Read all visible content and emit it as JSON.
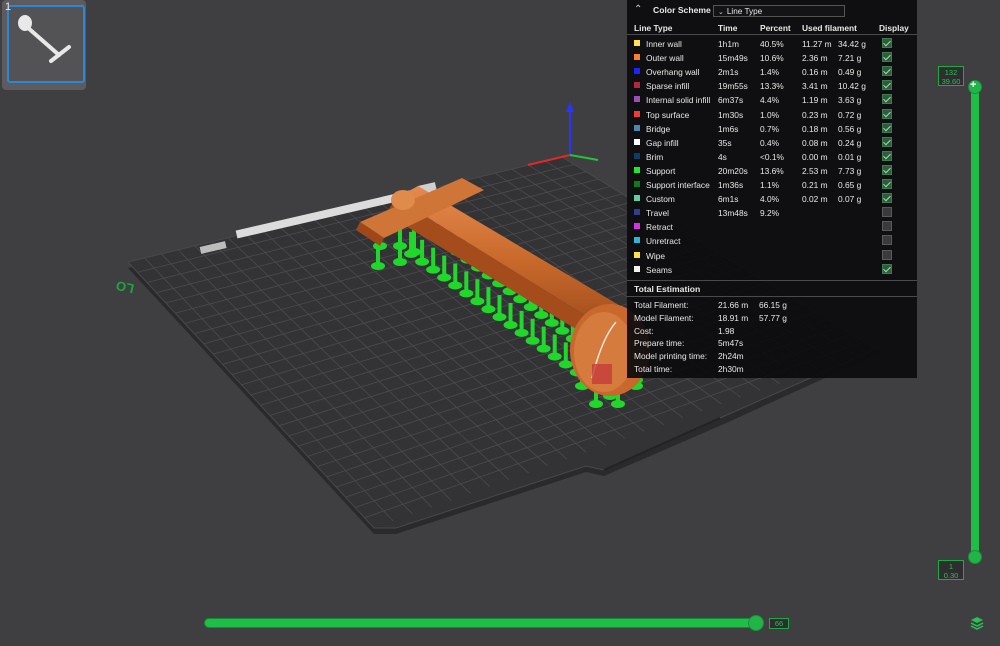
{
  "plate": {
    "number": "1"
  },
  "bed_label": "LO",
  "legend": {
    "title": "Color Scheme",
    "scheme": "Line Type",
    "headers": {
      "line_type": "Line Type",
      "time": "Time",
      "percent": "Percent",
      "used_filament": "Used filament",
      "display": "Display"
    },
    "rows": [
      {
        "name": "Inner wall",
        "time": "1h1m",
        "percent": "40.5%",
        "length": "11.27 m",
        "weight": "34.42 g",
        "color": "#ffe14d",
        "display": true
      },
      {
        "name": "Outer wall",
        "time": "15m49s",
        "percent": "10.6%",
        "length": "2.36 m",
        "weight": "7.21 g",
        "color": "#ff7c2a",
        "display": true
      },
      {
        "name": "Overhang wall",
        "time": "2m1s",
        "percent": "1.4%",
        "length": "0.16 m",
        "weight": "0.49 g",
        "color": "#1a24ff",
        "display": true
      },
      {
        "name": "Sparse infill",
        "time": "19m55s",
        "percent": "13.3%",
        "length": "3.41 m",
        "weight": "10.42 g",
        "color": "#b3283b",
        "display": true
      },
      {
        "name": "Internal solid infill",
        "time": "6m37s",
        "percent": "4.4%",
        "length": "1.19 m",
        "weight": "3.63 g",
        "color": "#9a4fb8",
        "display": true
      },
      {
        "name": "Top surface",
        "time": "1m30s",
        "percent": "1.0%",
        "length": "0.23 m",
        "weight": "0.72 g",
        "color": "#f23a3a",
        "display": true
      },
      {
        "name": "Bridge",
        "time": "1m6s",
        "percent": "0.7%",
        "length": "0.18 m",
        "weight": "0.56 g",
        "color": "#4d84b3",
        "display": true
      },
      {
        "name": "Gap infill",
        "time": "35s",
        "percent": "0.4%",
        "length": "0.08 m",
        "weight": "0.24 g",
        "color": "#ffffff",
        "display": true
      },
      {
        "name": "Brim",
        "time": "4s",
        "percent": "<0.1%",
        "length": "0.00 m",
        "weight": "0.01 g",
        "color": "#0d3d66",
        "display": true
      },
      {
        "name": "Support",
        "time": "20m20s",
        "percent": "13.6%",
        "length": "2.53 m",
        "weight": "7.73 g",
        "color": "#1ee82a",
        "display": true
      },
      {
        "name": "Support interface",
        "time": "1m36s",
        "percent": "1.1%",
        "length": "0.21 m",
        "weight": "0.65 g",
        "color": "#0f7a1a",
        "display": true
      },
      {
        "name": "Custom",
        "time": "6m1s",
        "percent": "4.0%",
        "length": "0.02 m",
        "weight": "0.07 g",
        "color": "#5ecf9f",
        "display": true
      },
      {
        "name": "Travel",
        "time": "13m48s",
        "percent": "9.2%",
        "length": "",
        "weight": "",
        "color": "#2f3e8f",
        "display": false
      },
      {
        "name": "Retract",
        "time": "",
        "percent": "",
        "length": "",
        "weight": "",
        "color": "#d633e0",
        "display": false
      },
      {
        "name": "Unretract",
        "time": "",
        "percent": "",
        "length": "",
        "weight": "",
        "color": "#2fb3d6",
        "display": false
      },
      {
        "name": "Wipe",
        "time": "",
        "percent": "",
        "length": "",
        "weight": "",
        "color": "#ffe24a",
        "display": false
      },
      {
        "name": "Seams",
        "time": "",
        "percent": "",
        "length": "",
        "weight": "",
        "color": "#f2f2f2",
        "display": true
      }
    ]
  },
  "totals": {
    "title": "Total Estimation",
    "rows": [
      {
        "label": "Total Filament:",
        "v1": "21.66 m",
        "v2": "66.15 g"
      },
      {
        "label": "Model Filament:",
        "v1": "18.91 m",
        "v2": "57.77 g"
      },
      {
        "label": "Cost:",
        "v1": "1.98",
        "v2": ""
      },
      {
        "label": "Prepare time:",
        "v1": "5m47s",
        "v2": ""
      },
      {
        "label": "Model printing time:",
        "v1": "2h24m",
        "v2": ""
      },
      {
        "label": "Total time:",
        "v1": "2h30m",
        "v2": ""
      }
    ]
  },
  "layer_slider": {
    "top_layer": "132",
    "top_height": "39.60",
    "bottom_layer": "1",
    "bottom_height": "0.30"
  },
  "move_slider": {
    "value": "66"
  },
  "icons": {
    "collapse": "collapse-up-icon",
    "dropdown": "chevron-down-icon",
    "layers": "layers-icon",
    "add": "plus-icon"
  }
}
